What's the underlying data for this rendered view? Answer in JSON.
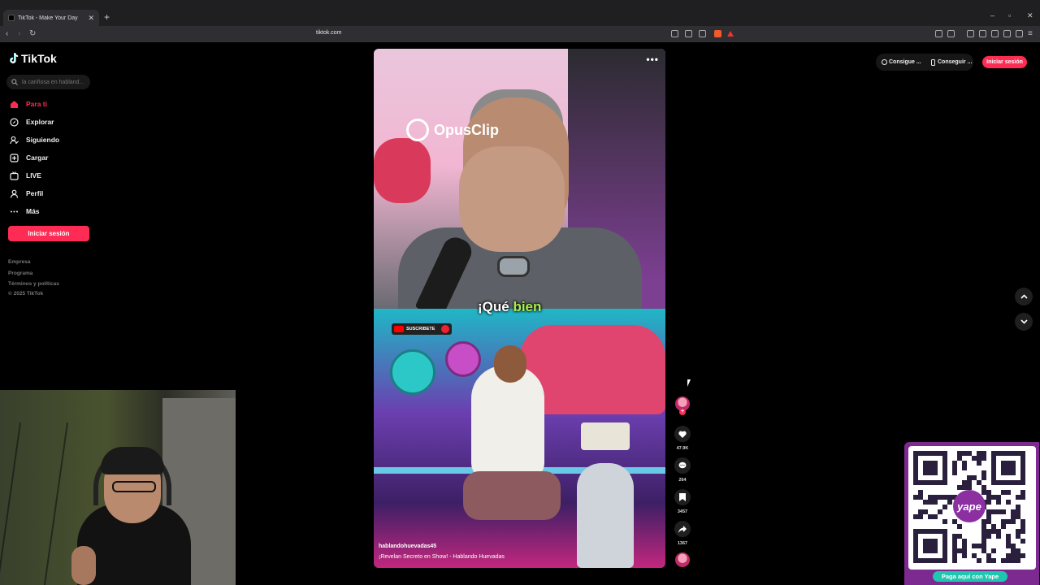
{
  "browser": {
    "tab_title": "TikTok - Make Your Day",
    "new_tab": "+",
    "url": "tiktok.com",
    "window_controls": [
      "–",
      "▫",
      "✕"
    ]
  },
  "sidebar": {
    "logo": "TikTok",
    "search_placeholder": "la cariñosa en habland...",
    "items": [
      {
        "label": "Para ti",
        "icon": "home-icon",
        "active": true
      },
      {
        "label": "Explorar",
        "icon": "compass-icon"
      },
      {
        "label": "Siguiendo",
        "icon": "following-icon"
      },
      {
        "label": "Cargar",
        "icon": "upload-icon"
      },
      {
        "label": "LIVE",
        "icon": "live-icon"
      },
      {
        "label": "Perfil",
        "icon": "profile-icon"
      },
      {
        "label": "Más",
        "icon": "more-icon"
      }
    ],
    "login_label": "Iniciar sesión",
    "footer": [
      "Empresa",
      "Programa",
      "Términos y políticas",
      "© 2025 TikTok"
    ]
  },
  "header": {
    "get_coins": "Consigue ...",
    "get_app": "Conseguir ...",
    "signin": "Iniciar sesión"
  },
  "video": {
    "watermark": "OpusClip",
    "caption_1": "¡Qué ",
    "caption_2": "bien",
    "subscribe": "SUSCRIBETE",
    "author": "hablandohuevadas45",
    "description": "¡Revelan Secreto en Show! - Hablando Huevadas"
  },
  "actions": {
    "likes": "47.9K",
    "comments": "264",
    "saves": "3457",
    "shares": "1367"
  },
  "overlay": {
    "qr_label": "Paga aquí con Yape",
    "qr_brand": "yape"
  },
  "colors": {
    "accent": "#fe2c55",
    "yape_purple": "#7c2a8f",
    "yape_teal": "#1fc6b0",
    "caption_green": "#a8ef4b"
  }
}
